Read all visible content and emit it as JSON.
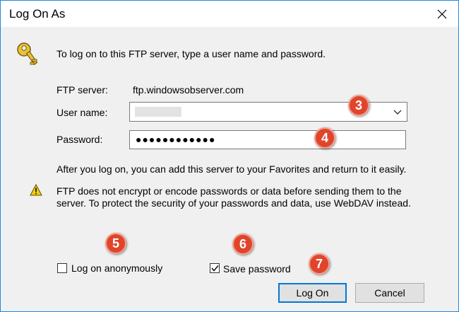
{
  "window": {
    "title": "Log On As"
  },
  "intro_text": "To log on to this FTP server, type a user name and password.",
  "server": {
    "label": "FTP server:",
    "value": "ftp.windowsobserver.com"
  },
  "username": {
    "label": "User name:",
    "value": ""
  },
  "password": {
    "label": "Password:",
    "value": "●●●●●●●●●●●●"
  },
  "after_text": "After you log on, you can add this server to your Favorites and return to it easily.",
  "warning": {
    "line1": "FTP does not encrypt or encode passwords or data before sending them to the",
    "line2": "server.  To protect the security of your passwords and data, use WebDAV instead."
  },
  "options": {
    "anonymous_label": "Log on anonymously",
    "anonymous_checked": false,
    "save_label": "Save password",
    "save_checked": true
  },
  "buttons": {
    "logon": "Log On",
    "cancel": "Cancel"
  },
  "badges": [
    "3",
    "4",
    "5",
    "6",
    "7"
  ],
  "colors": {
    "badge": "#e0452c",
    "accent": "#0078d7"
  }
}
